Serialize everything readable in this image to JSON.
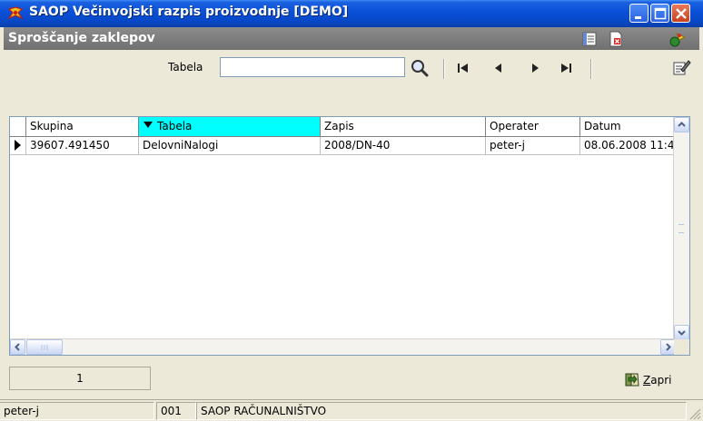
{
  "window": {
    "title": "SAOP Večinvojski razpis proizvodnje [DEMO]"
  },
  "header": {
    "subtitle": "Sproščanje zaklepov"
  },
  "toolbar": {
    "table_label": "Tabela",
    "table_value": "",
    "table_placeholder": ""
  },
  "grid": {
    "columns": [
      "Skupina",
      "Tabela",
      "Zapis",
      "Operater",
      "Datum"
    ],
    "sorted_column": "Tabela",
    "rows": [
      [
        "39607.491450",
        "DelovniNalogi",
        "2008/DN-40",
        "peter-j",
        "08.06.2008 11:4"
      ]
    ]
  },
  "footer": {
    "page": "1",
    "close_label_rest": "apri",
    "close_label_underlined": "Z"
  },
  "status": {
    "user": "peter-j",
    "code": "001",
    "company": "SAOP RAČUNALNIŠTVO"
  },
  "colors": {
    "titlebar": "#0a4fd8",
    "sorted_header": "#00ffff",
    "header_bar": "#7a7a7a"
  }
}
